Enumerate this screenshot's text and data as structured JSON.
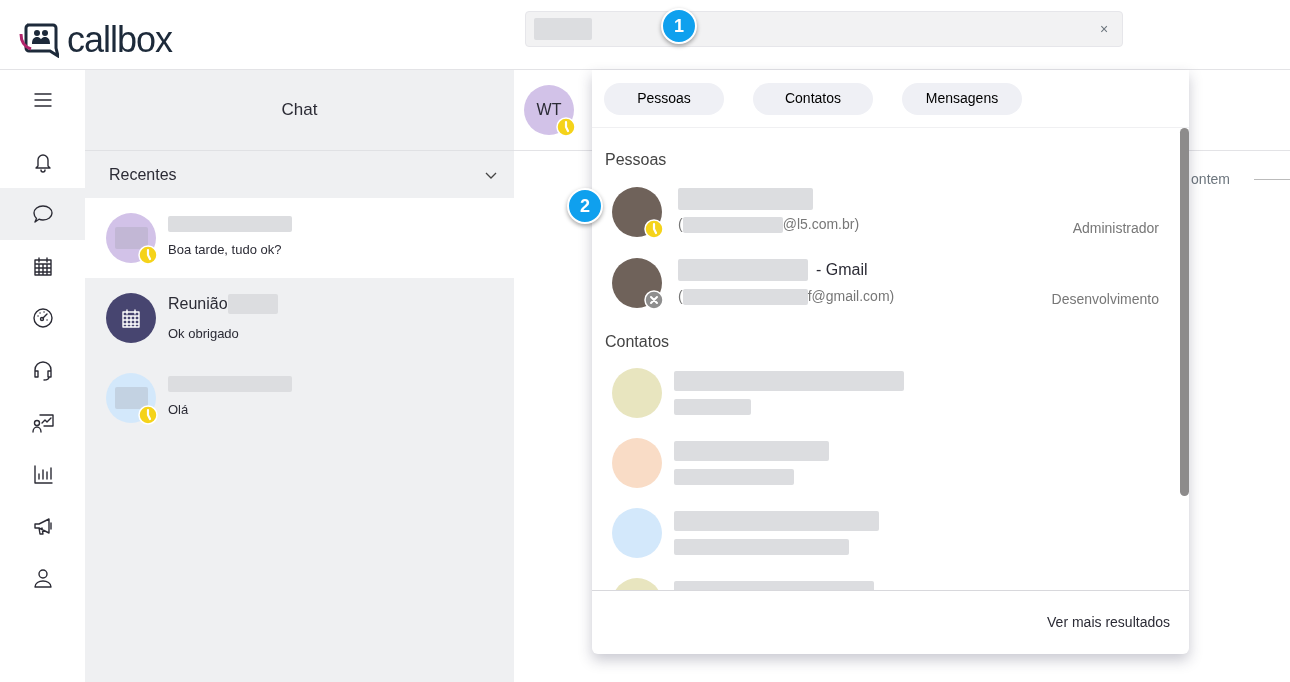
{
  "app": {
    "logo_text": "callbox"
  },
  "search": {
    "clear_symbol": "×"
  },
  "callouts": [
    {
      "number": "1"
    },
    {
      "number": "2"
    }
  ],
  "nav": [
    {
      "selected": false
    },
    {
      "selected": false
    },
    {
      "selected": true
    },
    {
      "selected": false
    },
    {
      "selected": false
    },
    {
      "selected": false
    },
    {
      "selected": false
    },
    {
      "selected": false
    },
    {
      "selected": false
    },
    {
      "selected": false
    }
  ],
  "chat_panel": {
    "title": "Chat",
    "section": "Recentes",
    "expanded": true,
    "items": [
      {
        "kind": "person",
        "message": "Boa tarde, tudo ok?",
        "color": "#d2c2e8",
        "away": true,
        "selected": true
      },
      {
        "kind": "meeting",
        "name": "Reunião",
        "message": "Ok obrigado",
        "color": "#474570",
        "away": false,
        "selected": false
      },
      {
        "kind": "person",
        "message": "Olá",
        "color": "#d3e8fb",
        "away": true,
        "selected": false
      }
    ]
  },
  "conversation": {
    "avatar_initials": "WT",
    "away": true,
    "date_divider": "ontem"
  },
  "dropdown": {
    "filters": [
      {
        "label": "Pessoas",
        "selected": false
      },
      {
        "label": "Contatos",
        "selected": false
      },
      {
        "label": "Mensagens",
        "selected": false
      }
    ],
    "people_heading": "Pessoas",
    "people": [
      {
        "email_open": "(",
        "email_suffix": "@l5.com.br)",
        "role": "Administrador",
        "away": true,
        "offline": false
      },
      {
        "name_suffix": "- Gmail",
        "email_open": "(",
        "email_suffix": "f@gmail.com)",
        "role": "Desenvolvimento",
        "away": false,
        "offline": true
      }
    ],
    "contacts_heading": "Contatos",
    "contacts": [
      {
        "color": "#e8e5bf"
      },
      {
        "color": "#f9dcc6"
      },
      {
        "color": "#d3e8fb"
      },
      {
        "color": "#e8e5bf"
      }
    ],
    "more_link": "Ver mais resultados"
  }
}
